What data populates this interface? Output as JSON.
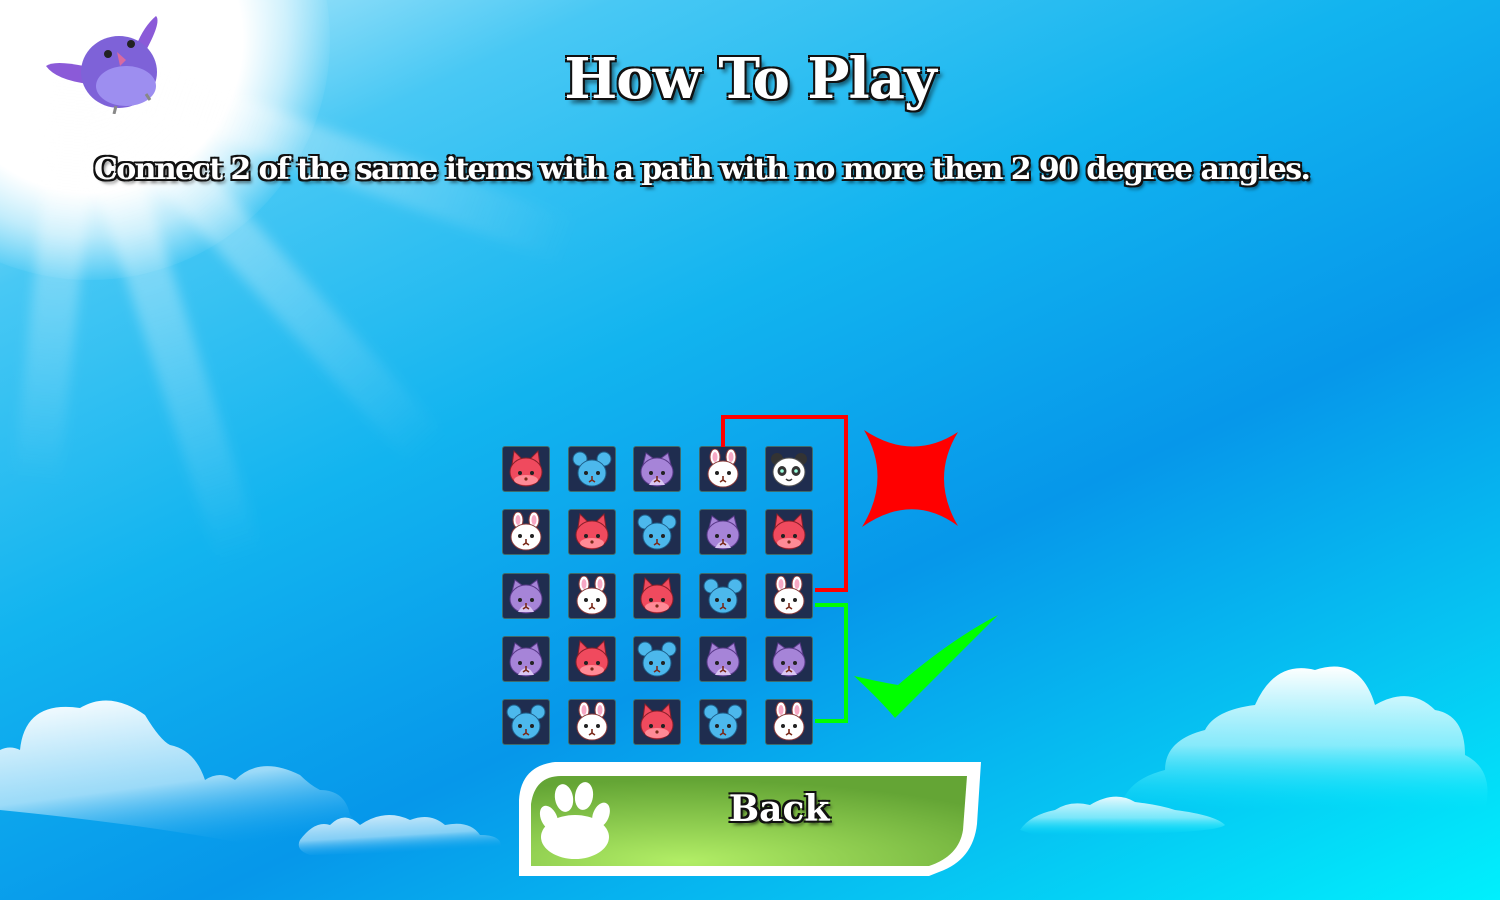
{
  "screen": {
    "title": "How To Play",
    "instructions": "Connect 2 of the same items with a path with no more then 2 90 degree angles."
  },
  "grid": {
    "rows": [
      [
        "fox",
        "mouse",
        "cat",
        "rabbit",
        "panda"
      ],
      [
        "rabbit",
        "fox",
        "mouse",
        "cat",
        "fox"
      ],
      [
        "cat",
        "rabbit",
        "fox",
        "mouse",
        "rabbit"
      ],
      [
        "cat",
        "fox",
        "mouse",
        "cat",
        "cat"
      ],
      [
        "mouse",
        "rabbit",
        "fox",
        "mouse",
        "rabbit"
      ]
    ]
  },
  "examples": {
    "invalid": {
      "icon": "red-x-icon",
      "color": "#ff0000",
      "from": [
        0,
        3
      ],
      "to": [
        2,
        4
      ],
      "valid": false
    },
    "valid": {
      "icon": "green-check-icon",
      "color": "#00ff00",
      "from": [
        2,
        4
      ],
      "to": [
        4,
        4
      ],
      "valid": true
    }
  },
  "buttons": {
    "back": {
      "label": "Back",
      "icon": "paw-icon"
    }
  },
  "colors": {
    "tile_bg": "#1f2d4f",
    "button_green": "#7cc045",
    "fox": "#f04a5e",
    "mouse": "#4cb8ec",
    "cat": "#a684d8",
    "rabbit": "#ffffff",
    "panda": "#ffffff"
  }
}
